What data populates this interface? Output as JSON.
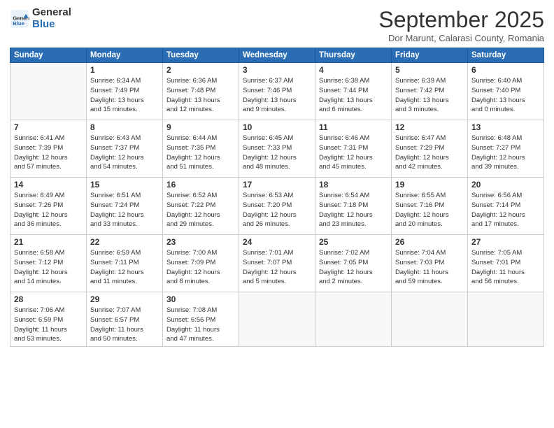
{
  "logo": {
    "general": "General",
    "blue": "Blue"
  },
  "header": {
    "month": "September 2025",
    "location": "Dor Marunt, Calarasi County, Romania"
  },
  "days_of_week": [
    "Sunday",
    "Monday",
    "Tuesday",
    "Wednesday",
    "Thursday",
    "Friday",
    "Saturday"
  ],
  "weeks": [
    [
      {
        "day": "",
        "info": ""
      },
      {
        "day": "1",
        "info": "Sunrise: 6:34 AM\nSunset: 7:49 PM\nDaylight: 13 hours\nand 15 minutes."
      },
      {
        "day": "2",
        "info": "Sunrise: 6:36 AM\nSunset: 7:48 PM\nDaylight: 13 hours\nand 12 minutes."
      },
      {
        "day": "3",
        "info": "Sunrise: 6:37 AM\nSunset: 7:46 PM\nDaylight: 13 hours\nand 9 minutes."
      },
      {
        "day": "4",
        "info": "Sunrise: 6:38 AM\nSunset: 7:44 PM\nDaylight: 13 hours\nand 6 minutes."
      },
      {
        "day": "5",
        "info": "Sunrise: 6:39 AM\nSunset: 7:42 PM\nDaylight: 13 hours\nand 3 minutes."
      },
      {
        "day": "6",
        "info": "Sunrise: 6:40 AM\nSunset: 7:40 PM\nDaylight: 13 hours\nand 0 minutes."
      }
    ],
    [
      {
        "day": "7",
        "info": "Sunrise: 6:41 AM\nSunset: 7:39 PM\nDaylight: 12 hours\nand 57 minutes."
      },
      {
        "day": "8",
        "info": "Sunrise: 6:43 AM\nSunset: 7:37 PM\nDaylight: 12 hours\nand 54 minutes."
      },
      {
        "day": "9",
        "info": "Sunrise: 6:44 AM\nSunset: 7:35 PM\nDaylight: 12 hours\nand 51 minutes."
      },
      {
        "day": "10",
        "info": "Sunrise: 6:45 AM\nSunset: 7:33 PM\nDaylight: 12 hours\nand 48 minutes."
      },
      {
        "day": "11",
        "info": "Sunrise: 6:46 AM\nSunset: 7:31 PM\nDaylight: 12 hours\nand 45 minutes."
      },
      {
        "day": "12",
        "info": "Sunrise: 6:47 AM\nSunset: 7:29 PM\nDaylight: 12 hours\nand 42 minutes."
      },
      {
        "day": "13",
        "info": "Sunrise: 6:48 AM\nSunset: 7:27 PM\nDaylight: 12 hours\nand 39 minutes."
      }
    ],
    [
      {
        "day": "14",
        "info": "Sunrise: 6:49 AM\nSunset: 7:26 PM\nDaylight: 12 hours\nand 36 minutes."
      },
      {
        "day": "15",
        "info": "Sunrise: 6:51 AM\nSunset: 7:24 PM\nDaylight: 12 hours\nand 33 minutes."
      },
      {
        "day": "16",
        "info": "Sunrise: 6:52 AM\nSunset: 7:22 PM\nDaylight: 12 hours\nand 29 minutes."
      },
      {
        "day": "17",
        "info": "Sunrise: 6:53 AM\nSunset: 7:20 PM\nDaylight: 12 hours\nand 26 minutes."
      },
      {
        "day": "18",
        "info": "Sunrise: 6:54 AM\nSunset: 7:18 PM\nDaylight: 12 hours\nand 23 minutes."
      },
      {
        "day": "19",
        "info": "Sunrise: 6:55 AM\nSunset: 7:16 PM\nDaylight: 12 hours\nand 20 minutes."
      },
      {
        "day": "20",
        "info": "Sunrise: 6:56 AM\nSunset: 7:14 PM\nDaylight: 12 hours\nand 17 minutes."
      }
    ],
    [
      {
        "day": "21",
        "info": "Sunrise: 6:58 AM\nSunset: 7:12 PM\nDaylight: 12 hours\nand 14 minutes."
      },
      {
        "day": "22",
        "info": "Sunrise: 6:59 AM\nSunset: 7:11 PM\nDaylight: 12 hours\nand 11 minutes."
      },
      {
        "day": "23",
        "info": "Sunrise: 7:00 AM\nSunset: 7:09 PM\nDaylight: 12 hours\nand 8 minutes."
      },
      {
        "day": "24",
        "info": "Sunrise: 7:01 AM\nSunset: 7:07 PM\nDaylight: 12 hours\nand 5 minutes."
      },
      {
        "day": "25",
        "info": "Sunrise: 7:02 AM\nSunset: 7:05 PM\nDaylight: 12 hours\nand 2 minutes."
      },
      {
        "day": "26",
        "info": "Sunrise: 7:04 AM\nSunset: 7:03 PM\nDaylight: 11 hours\nand 59 minutes."
      },
      {
        "day": "27",
        "info": "Sunrise: 7:05 AM\nSunset: 7:01 PM\nDaylight: 11 hours\nand 56 minutes."
      }
    ],
    [
      {
        "day": "28",
        "info": "Sunrise: 7:06 AM\nSunset: 6:59 PM\nDaylight: 11 hours\nand 53 minutes."
      },
      {
        "day": "29",
        "info": "Sunrise: 7:07 AM\nSunset: 6:57 PM\nDaylight: 11 hours\nand 50 minutes."
      },
      {
        "day": "30",
        "info": "Sunrise: 7:08 AM\nSunset: 6:56 PM\nDaylight: 11 hours\nand 47 minutes."
      },
      {
        "day": "",
        "info": ""
      },
      {
        "day": "",
        "info": ""
      },
      {
        "day": "",
        "info": ""
      },
      {
        "day": "",
        "info": ""
      }
    ]
  ]
}
